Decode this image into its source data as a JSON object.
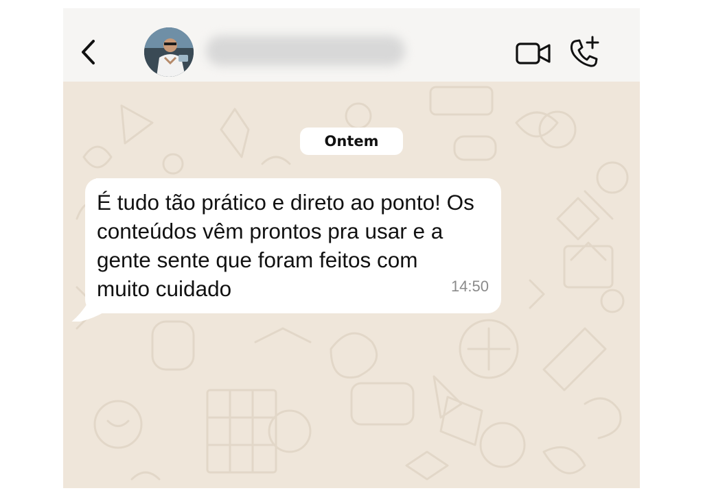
{
  "header": {
    "back_icon": "chevron-left-icon",
    "avatar": "contact-photo",
    "contact_name": "",
    "video_call_icon": "video-camera-icon",
    "voice_call_icon": "phone-plus-icon"
  },
  "chat": {
    "date_separator": "Ontem",
    "messages": [
      {
        "text": "É tudo tão prático e direto ao ponto! Os\nconteúdos vêm prontos pra usar e a\ngente sente que foram feitos com\nmuito cuidado",
        "time": "14:50",
        "direction": "incoming"
      }
    ]
  },
  "colors": {
    "header_bg": "#f6f5f3",
    "chat_bg": "#efe6da",
    "bubble_bg": "#ffffff",
    "timestamp": "#8a8a8a",
    "icon": "#111111"
  }
}
